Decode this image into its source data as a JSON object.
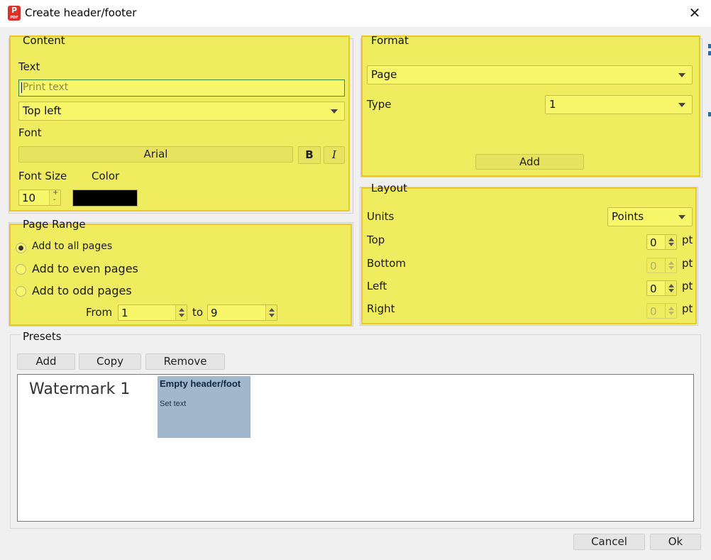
{
  "window": {
    "title": "Create header/footer",
    "app_icon_text": "P",
    "app_icon_sub": "PDF"
  },
  "content": {
    "legend": "Content",
    "text_label": "Text",
    "text_placeholder": "Print text",
    "text_value": "",
    "position_value": "Top left",
    "font_label": "Font",
    "font_value": "Arial",
    "bold_label": "B",
    "italic_label": "I",
    "font_size_label": "Font Size",
    "color_label": "Color",
    "font_size_value": "10",
    "color_value": "#000000"
  },
  "format": {
    "legend": "Format",
    "format_value": "Page",
    "type_label": "Type",
    "type_value": "1",
    "add_label": "Add"
  },
  "layout": {
    "legend": "Layout",
    "units_label": "Units",
    "units_value": "Points",
    "rows": [
      {
        "label": "Top",
        "value": "0",
        "unit": "pt",
        "enabled": true
      },
      {
        "label": "Bottom",
        "value": "0",
        "unit": "pt",
        "enabled": false
      },
      {
        "label": "Left",
        "value": "0",
        "unit": "pt",
        "enabled": true
      },
      {
        "label": "Right",
        "value": "0",
        "unit": "pt",
        "enabled": false
      }
    ]
  },
  "page_range": {
    "legend": "Page Range",
    "options": [
      {
        "label": "Add to all pages",
        "checked": true
      },
      {
        "label": "Add to even pages",
        "checked": false
      },
      {
        "label": "Add to odd pages",
        "checked": false
      }
    ],
    "from_label": "From",
    "from_value": "1",
    "to_label": "to",
    "to_value": "9"
  },
  "presets": {
    "legend": "Presets",
    "add_label": "Add",
    "copy_label": "Copy",
    "remove_label": "Remove",
    "items": [
      {
        "label": "Watermark 1"
      },
      {
        "title": "Empty header/foot",
        "subtitle": "Set text",
        "selected": true
      }
    ]
  },
  "footer": {
    "cancel_label": "Cancel",
    "ok_label": "Ok"
  },
  "colors": {
    "highlight": "#f0ec5f",
    "highlight_border": "#e8c82a",
    "selected_preset": "#a1b8cc"
  }
}
